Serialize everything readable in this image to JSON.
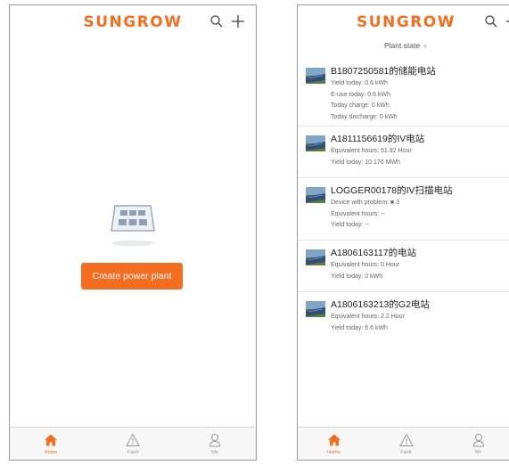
{
  "brand": {
    "logo": "SUNGROW",
    "accent": "#f36e21"
  },
  "left_screen": {
    "create_button": "Create power plant"
  },
  "right_screen": {
    "filter_label": "Plant state",
    "plants": [
      {
        "name": "B1807250581的储能电站",
        "lines": [
          "Yield today:  0.6 kWh",
          "E-use today:  0.6 kWh",
          "Today charge:  0 kWh",
          "Today discharge:  0 kWh"
        ]
      },
      {
        "name": "A1811156619的IV电站",
        "lines": [
          "Equivalent hours:  51.92 Hour",
          "Yield today:  10.176 MWh"
        ]
      },
      {
        "name": "LOGGER00178的IV扫描电站",
        "lines": [
          "Device with problem:  ■ 3",
          "Equivalent hours:  --",
          "Yield today:  --"
        ]
      },
      {
        "name": "A1806163117的电站",
        "lines": [
          "Equivalent hours:  0 Hour",
          "Yield today:  0 kWh"
        ]
      },
      {
        "name": "A1806163213的G2电站",
        "lines": [
          "Equivalent hours:  2.2 Hour",
          "Yield today:  6.6 kWh"
        ]
      }
    ]
  },
  "tabs": [
    {
      "label": "Home",
      "icon": "home-icon",
      "active": true
    },
    {
      "label": "Fault",
      "icon": "fault-icon",
      "active": false
    },
    {
      "label": "Me",
      "icon": "user-icon",
      "active": false
    }
  ]
}
